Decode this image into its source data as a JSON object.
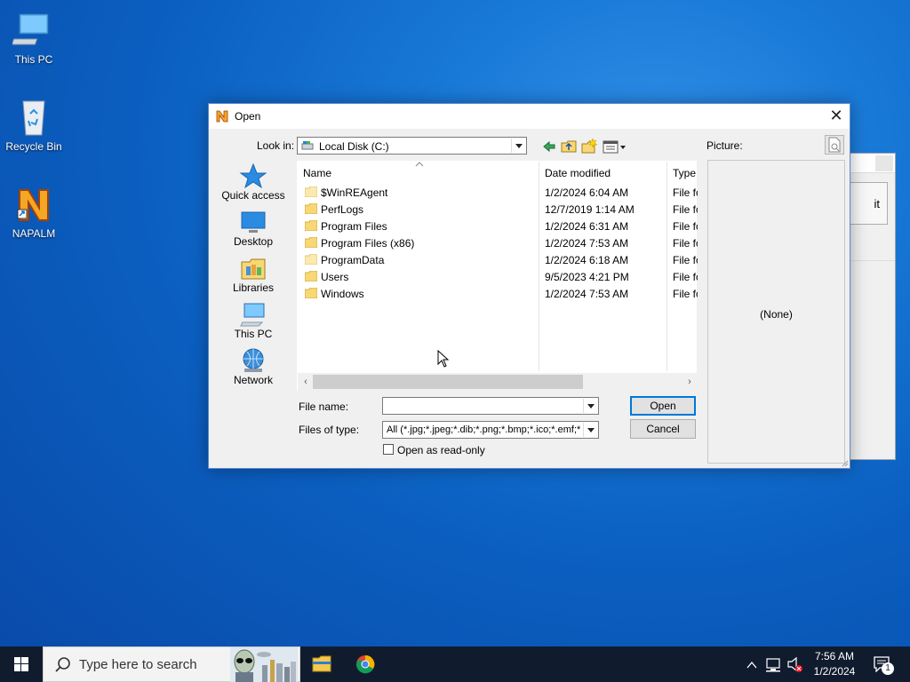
{
  "desktop": {
    "icons": [
      {
        "label": "This PC"
      },
      {
        "label": "Recycle Bin"
      },
      {
        "label": "NAPALM"
      }
    ]
  },
  "background_window": {
    "button_partial_text": "it"
  },
  "dialog": {
    "title": "Open",
    "look_in_label": "Look in:",
    "look_in_value": "Local Disk (C:)",
    "picture_label": "Picture:",
    "places": [
      "Quick access",
      "Desktop",
      "Libraries",
      "This PC",
      "Network"
    ],
    "columns": {
      "name": "Name",
      "date": "Date modified",
      "type": "Type"
    },
    "files": [
      {
        "name": "$WinREAgent",
        "date": "1/2/2024 6:04 AM",
        "type": "File fo"
      },
      {
        "name": "PerfLogs",
        "date": "12/7/2019 1:14 AM",
        "type": "File fo"
      },
      {
        "name": "Program Files",
        "date": "1/2/2024 6:31 AM",
        "type": "File fo"
      },
      {
        "name": "Program Files (x86)",
        "date": "1/2/2024 7:53 AM",
        "type": "File fo"
      },
      {
        "name": "ProgramData",
        "date": "1/2/2024 6:18 AM",
        "type": "File fo"
      },
      {
        "name": "Users",
        "date": "9/5/2023 4:21 PM",
        "type": "File fo"
      },
      {
        "name": "Windows",
        "date": "1/2/2024 7:53 AM",
        "type": "File fo"
      }
    ],
    "preview_text": "(None)",
    "file_name_label": "File name:",
    "file_name_value": "",
    "files_of_type_label": "Files of type:",
    "files_of_type_value": "All (*.jpg;*.jpeg;*.dib;*.png;*.bmp;*.ico;*.emf;*.wmf)",
    "open_button": "Open",
    "cancel_button": "Cancel",
    "read_only_label": "Open as read-only",
    "read_only_checked": false
  },
  "taskbar": {
    "search_placeholder": "Type here to search",
    "time": "7:56 AM",
    "date": "1/2/2024",
    "notification_count": "1"
  },
  "colors": {
    "desktop_blue": "#0b5fc0",
    "taskbar": "#101c2e",
    "dialog_bg": "#f0f0f0",
    "folder_yellow": "#f8d775",
    "accent": "#0078d7"
  }
}
